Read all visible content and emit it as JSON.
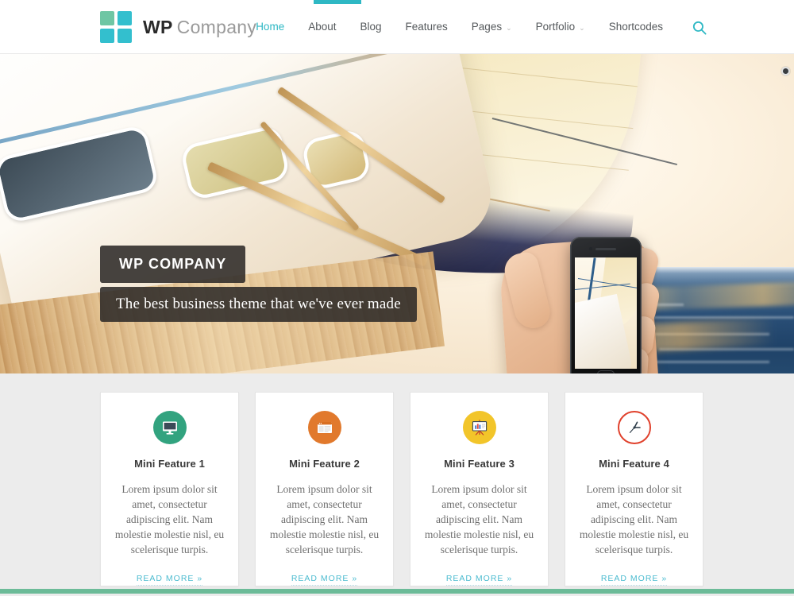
{
  "brand": {
    "name_bold": "WP",
    "name_light": "Company",
    "logo_icon": "four-squares-logo",
    "colors": {
      "accent_teal": "#2eb8c4",
      "logo_green": "#6ec6a4",
      "logo_teal": "#33bfce"
    }
  },
  "nav": {
    "items": [
      {
        "label": "Home",
        "active": true,
        "has_dropdown": false
      },
      {
        "label": "About",
        "active": false,
        "has_dropdown": false
      },
      {
        "label": "Blog",
        "active": false,
        "has_dropdown": false
      },
      {
        "label": "Features",
        "active": false,
        "has_dropdown": false
      },
      {
        "label": "Pages",
        "active": false,
        "has_dropdown": true
      },
      {
        "label": "Portfolio",
        "active": false,
        "has_dropdown": true
      },
      {
        "label": "Shortcodes",
        "active": false,
        "has_dropdown": false
      }
    ],
    "caret_glyph": "⌄",
    "search_icon": "search-icon"
  },
  "hero": {
    "image_description": "sailboat at sunset with hand holding smartphone",
    "caption_title": "WP COMPANY",
    "caption_subtitle": "The best business theme that we've ever made",
    "slider_dot": "slider-bullet"
  },
  "features": {
    "read_more_label": "READ MORE »",
    "body_text": "Lorem ipsum dolor sit amet, consectetur adipiscing elit. Nam molestie molestie nisl, eu scelerisque turpis.",
    "cards": [
      {
        "title": "Mini Feature 1",
        "icon": "desktop-monitor-icon",
        "icon_color": "#32a37f",
        "body": "Lorem ipsum dolor sit amet, consectetur adipiscing elit. Nam molestie molestie nisl, eu scelerisque turpis.",
        "link": "READ MORE »"
      },
      {
        "title": "Mini Feature 2",
        "icon": "browser-window-icon",
        "icon_color": "#e1792c",
        "body": "Lorem ipsum dolor sit amet, consectetur adipiscing elit. Nam molestie molestie nisl, eu scelerisque turpis.",
        "link": "READ MORE »"
      },
      {
        "title": "Mini Feature 3",
        "icon": "presentation-chart-icon",
        "icon_color": "#f2c52a",
        "body": "Lorem ipsum dolor sit amet, consectetur adipiscing elit. Nam molestie molestie nisl, eu scelerisque turpis.",
        "link": "READ MORE »"
      },
      {
        "title": "Mini Feature 4",
        "icon": "clock-icon",
        "icon_color": "#e0412c",
        "body": "Lorem ipsum dolor sit amet, consectetur adipiscing elit. Nam molestie molestie nisl, eu scelerisque turpis.",
        "link": "READ MORE »"
      }
    ]
  },
  "footer_accent_color": "#6cbb98"
}
